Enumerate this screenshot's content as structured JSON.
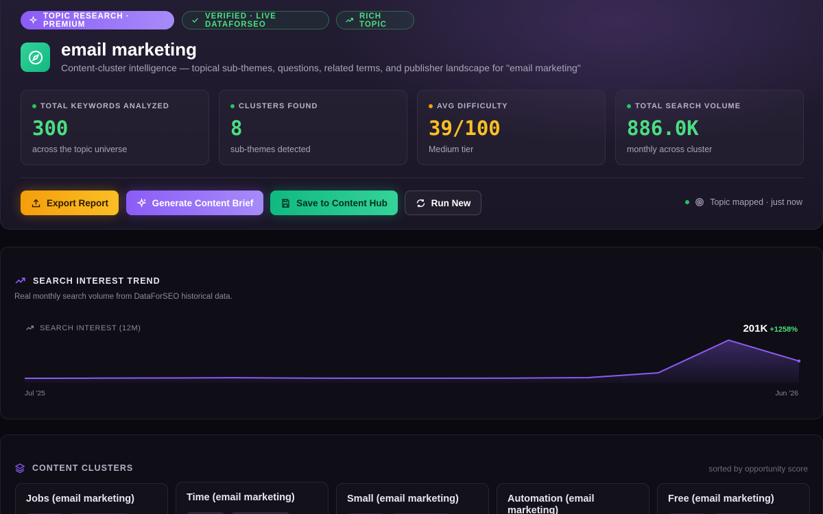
{
  "header": {
    "badges": {
      "premium": "TOPIC RESEARCH · PREMIUM",
      "verified": "VERIFIED · LIVE DATAFORSEO",
      "rich": "RICH TOPIC"
    },
    "title": "email marketing",
    "subtitle": "Content-cluster intelligence — topical sub-themes, questions, related terms, and publisher landscape for \"email marketing\""
  },
  "stats": [
    {
      "label": "TOTAL KEYWORDS ANALYZED",
      "value": "300",
      "note": "across the topic universe",
      "color": "#4ade80"
    },
    {
      "label": "CLUSTERS FOUND",
      "value": "8",
      "note": "sub-themes detected",
      "color": "#4ade80"
    },
    {
      "label": "AVG DIFFICULTY",
      "value": "39/100",
      "note": "Medium tier",
      "color": "#fbbf24"
    },
    {
      "label": "TOTAL SEARCH VOLUME",
      "value": "886.0K",
      "note": "monthly across cluster",
      "color": "#4ade80"
    }
  ],
  "actions": {
    "export": "Export Report",
    "brief": "Generate Content Brief",
    "save": "Save to Content Hub",
    "run_new": "Run New"
  },
  "status": "Topic mapped · just now",
  "trend": {
    "heading": "SEARCH INTEREST TREND",
    "subheading": "Real monthly search volume from DataForSEO historical data.",
    "chart_label": "SEARCH INTEREST (12M)",
    "latest_value": "201K",
    "change": "+1258%"
  },
  "chart_data": {
    "type": "area",
    "x": [
      "Jul '25",
      "Aug '25",
      "Sep '25",
      "Oct '25",
      "Nov '25",
      "Dec '25",
      "Jan '26",
      "Feb '26",
      "Mar '26",
      "Apr '26",
      "May '26",
      "Jun '26"
    ],
    "tick_labels": [
      "Jul '25",
      "Jun '26"
    ],
    "values": [
      13000,
      13500,
      14000,
      14800,
      13500,
      13200,
      13300,
      13600,
      15000,
      28000,
      117000,
      60000
    ],
    "title": "SEARCH INTEREST (12M)",
    "ylim": [
      0,
      125000
    ],
    "grid": false,
    "color": "#8b5cf6"
  },
  "clusters": {
    "heading": "CONTENT CLUSTERS",
    "sorted_note": "sorted by opportunity score",
    "items": [
      {
        "name": "Jobs (email marketing)"
      },
      {
        "name": "Time (email marketing)"
      },
      {
        "name": "Small (email marketing)"
      },
      {
        "name": "Automation (email marketing)"
      },
      {
        "name": "Free (email marketing)"
      }
    ]
  }
}
